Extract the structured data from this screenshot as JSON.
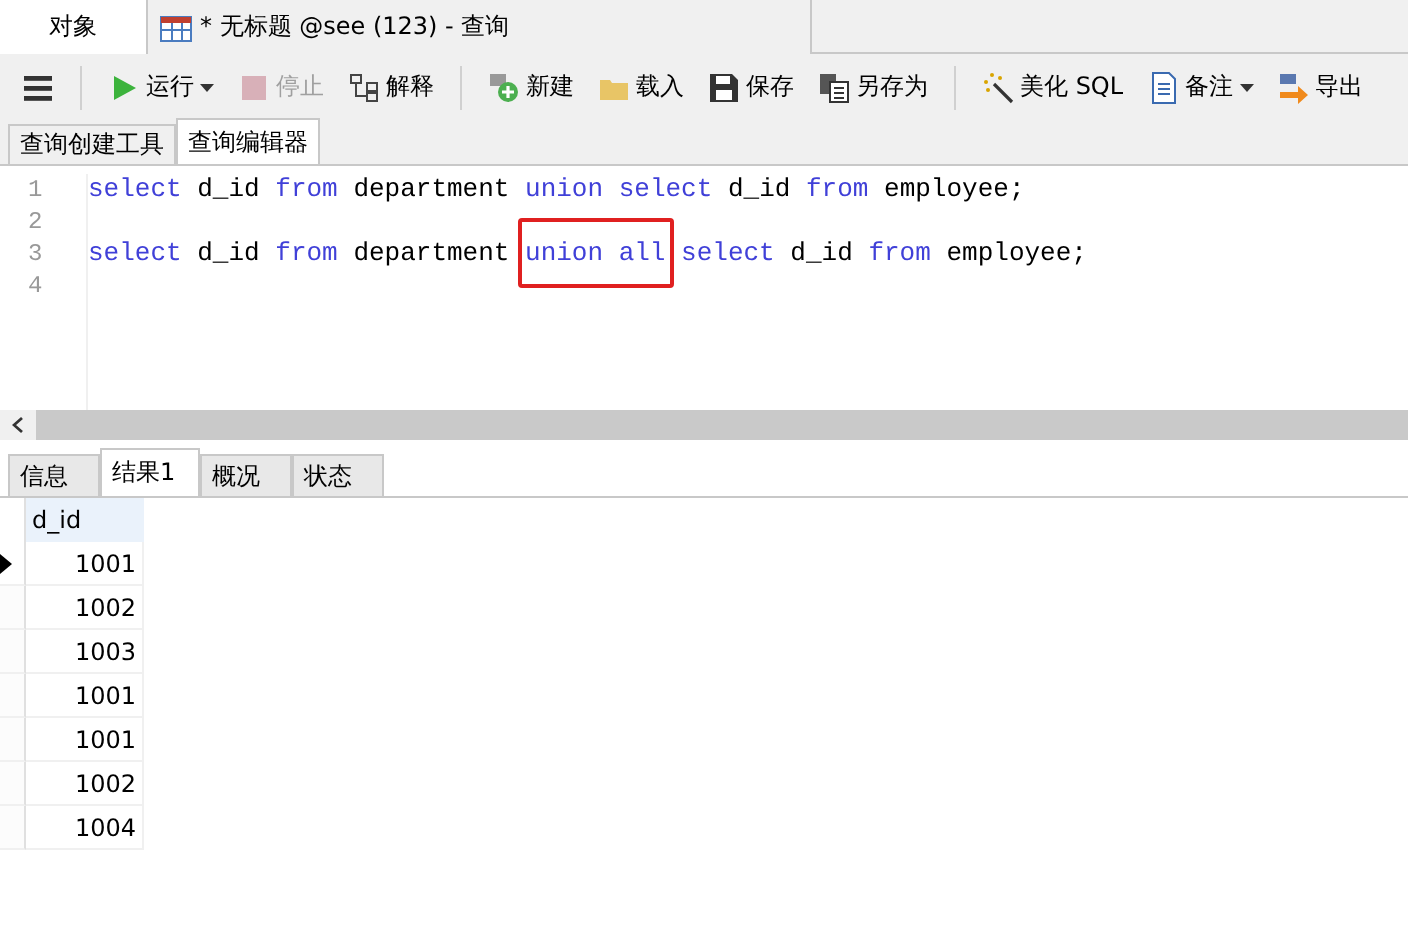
{
  "window_tabs": [
    {
      "label": "对象",
      "selected": false
    },
    {
      "label": "* 无标题 @see (123) - 查询",
      "selected": true
    }
  ],
  "toolbar_groups": [
    [
      {
        "label": "运行",
        "disabled": false,
        "dropdown": true
      },
      {
        "label": "停止",
        "disabled": true,
        "dropdown": false
      },
      {
        "label": "解释",
        "disabled": false,
        "dropdown": false
      }
    ],
    [
      {
        "label": "新建",
        "disabled": false,
        "dropdown": false
      },
      {
        "label": "载入",
        "disabled": false,
        "dropdown": false
      },
      {
        "label": "保存",
        "disabled": false,
        "dropdown": false
      },
      {
        "label": "另存为",
        "disabled": false,
        "dropdown": false
      }
    ],
    [
      {
        "label": "美化 SQL",
        "disabled": false,
        "dropdown": false
      },
      {
        "label": "备注",
        "disabled": false,
        "dropdown": true
      },
      {
        "label": "导出",
        "disabled": false,
        "dropdown": false
      }
    ]
  ],
  "editor_tabs": [
    {
      "label": "查询创建工具",
      "selected": false
    },
    {
      "label": "查询编辑器",
      "selected": true
    }
  ],
  "editor": {
    "lines": [
      {
        "number": "1",
        "tokens": [
          {
            "text": "select",
            "kind": "keyword",
            "boxed": false
          },
          {
            "text": "d_id",
            "kind": "ident",
            "boxed": false
          },
          {
            "text": "from",
            "kind": "keyword",
            "boxed": false
          },
          {
            "text": "department",
            "kind": "ident",
            "boxed": false
          },
          {
            "text": "union",
            "kind": "keyword",
            "boxed": false
          },
          {
            "text": "select",
            "kind": "keyword",
            "boxed": false
          },
          {
            "text": "d_id",
            "kind": "ident",
            "boxed": false
          },
          {
            "text": "from",
            "kind": "keyword",
            "boxed": false
          },
          {
            "text": "employee;",
            "kind": "ident",
            "boxed": false
          }
        ]
      },
      {
        "number": "2"
      },
      {
        "number": "3",
        "tokens": [
          {
            "text": "select",
            "kind": "keyword",
            "boxed": false
          },
          {
            "text": "d_id",
            "kind": "ident",
            "boxed": false
          },
          {
            "text": "from",
            "kind": "keyword",
            "boxed": false
          },
          {
            "text": "department",
            "kind": "ident",
            "boxed": false
          },
          {
            "text": "union all",
            "kind": "keyword",
            "boxed": true
          },
          {
            "text": "select",
            "kind": "keyword",
            "boxed": false
          },
          {
            "text": "d_id",
            "kind": "ident",
            "boxed": false
          },
          {
            "text": "from",
            "kind": "keyword",
            "boxed": false
          },
          {
            "text": "employee;",
            "kind": "ident",
            "boxed": false
          }
        ]
      },
      {
        "number": "4"
      }
    ]
  },
  "result_tabs": [
    {
      "label": "信息",
      "selected": false
    },
    {
      "label": "结果1",
      "selected": true
    },
    {
      "label": "概况",
      "selected": false
    },
    {
      "label": "状态",
      "selected": false
    }
  ],
  "result_grid": {
    "columns": [
      "d_id"
    ],
    "rows": [
      {
        "cells": [
          "1001"
        ],
        "current": true
      },
      {
        "cells": [
          "1002"
        ],
        "current": false
      },
      {
        "cells": [
          "1003"
        ],
        "current": false
      },
      {
        "cells": [
          "1001"
        ],
        "current": false
      },
      {
        "cells": [
          "1001"
        ],
        "current": false
      },
      {
        "cells": [
          "1002"
        ],
        "current": false
      },
      {
        "cells": [
          "1004"
        ],
        "current": false
      }
    ]
  }
}
